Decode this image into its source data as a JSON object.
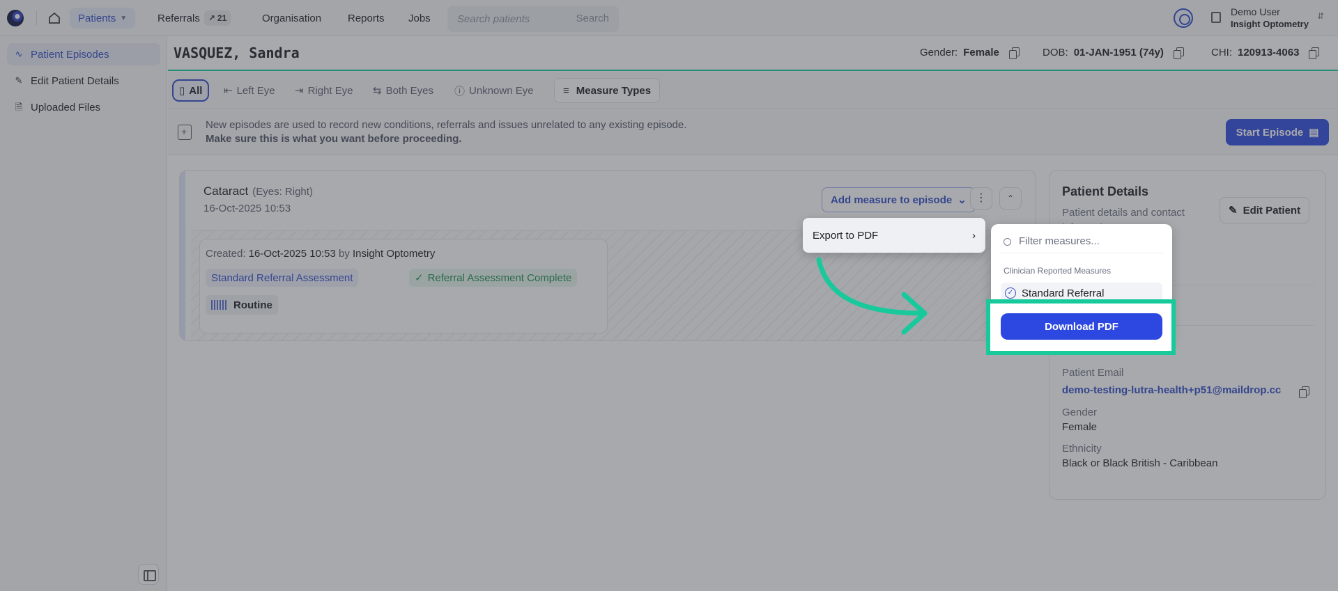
{
  "nav": {
    "patients": "Patients",
    "referrals": "Referrals",
    "referrals_badge": "21",
    "organisation": "Organisation",
    "reports": "Reports",
    "jobs": "Jobs",
    "search_placeholder": "Search patients",
    "search_button": "Search",
    "user_name": "Demo User",
    "user_org": "Insight Optometry"
  },
  "sidebar": {
    "items": [
      {
        "label": "Patient Episodes",
        "icon": "pulse-icon"
      },
      {
        "label": "Edit Patient Details",
        "icon": "pencil-icon"
      },
      {
        "label": "Uploaded Files",
        "icon": "file-upload-icon"
      }
    ]
  },
  "patient": {
    "name": "VASQUEZ, Sandra",
    "gender_label": "Gender:",
    "gender": "Female",
    "dob_label": "DOB:",
    "dob": "01-JAN-1951 (74y)",
    "chi_label": "CHI:",
    "chi": "120913-4063"
  },
  "filters": {
    "all": "All",
    "left_eye": "Left Eye",
    "right_eye": "Right Eye",
    "both_eyes": "Both Eyes",
    "unknown_eye": "Unknown Eye",
    "measure_types": "Measure Types"
  },
  "banner": {
    "line1": "New episodes are used to record new conditions, referrals and issues unrelated to any existing episode.",
    "line2": "Make sure this is what you want before proceeding.",
    "start_episode": "Start Episode"
  },
  "episode": {
    "title": "Cataract",
    "eyes": "(Eyes: Right)",
    "date": "16-Oct-2025 10:53",
    "created_label": "Created:",
    "created_date": "16-Oct-2025 10:53",
    "by": "by",
    "created_by": "Insight Optometry",
    "assessment": "Standard Referral Assessment",
    "assessment_status": "Referral Assessment Complete",
    "priority": "Routine",
    "add_measure": "Add measure to episode"
  },
  "details": {
    "title": "Patient Details",
    "subtitle": "Patient details and contact information",
    "edit": "Edit Patient",
    "email_label": "Patient Email",
    "email": "demo-testing-lutra-health+p51@maildrop.cc",
    "gender_label": "Gender",
    "gender": "Female",
    "ethnicity_label": "Ethnicity",
    "ethnicity": "Black or Black British - Caribbean"
  },
  "menu": {
    "export_pdf": "Export to PDF",
    "filter_placeholder": "Filter measures...",
    "group": "Clinician Reported Measures",
    "option": "Standard Referral",
    "download": "Download PDF"
  },
  "colors": {
    "accent": "#2c48e0",
    "highlight": "#18c99c",
    "success": "#1f8a50"
  }
}
